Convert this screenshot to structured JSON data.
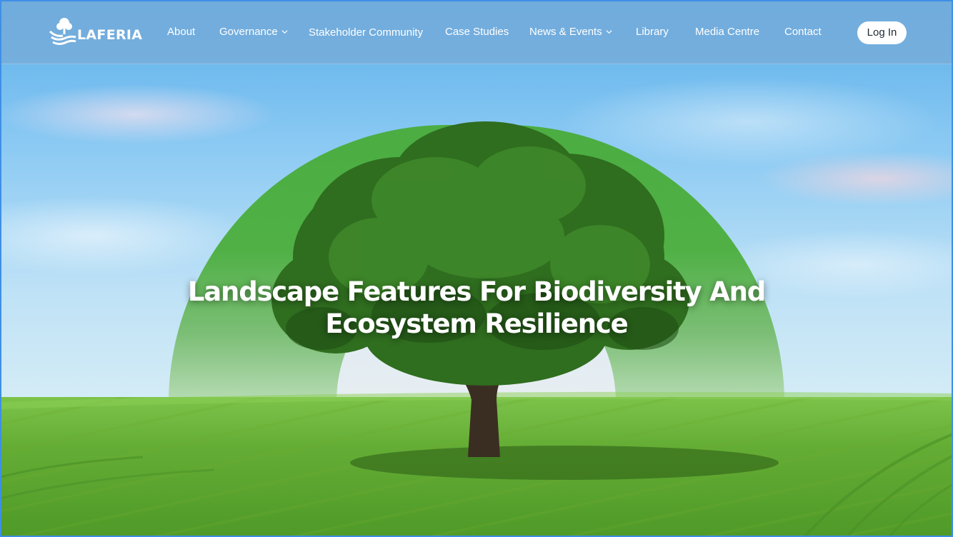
{
  "brand": {
    "name": "LAFERIA",
    "logo_icon": "tree-water-icon"
  },
  "nav": {
    "items": [
      {
        "label": "About",
        "has_dropdown": false
      },
      {
        "label": "Governance",
        "has_dropdown": true
      },
      {
        "label": "Stakeholder Community",
        "has_dropdown": false
      },
      {
        "label": "Case Studies",
        "has_dropdown": false
      },
      {
        "label": "News & Events",
        "has_dropdown": true
      },
      {
        "label": "Library",
        "has_dropdown": false
      },
      {
        "label": "Media Centre",
        "has_dropdown": false
      },
      {
        "label": "Contact",
        "has_dropdown": false
      }
    ],
    "login_label": "Log In",
    "dropdown_icon": "chevron-down-icon"
  },
  "hero": {
    "title_line1": "Landscape Features For Biodiversity And",
    "title_line2": "Ecosystem Resilience",
    "image_subject": "lone oak tree in green field under blue sky"
  },
  "colors": {
    "arch_green": "#4daf40",
    "nav_bg": "#78aad7",
    "frame_blue": "#3f8fe6",
    "text_white": "#ffffff"
  }
}
